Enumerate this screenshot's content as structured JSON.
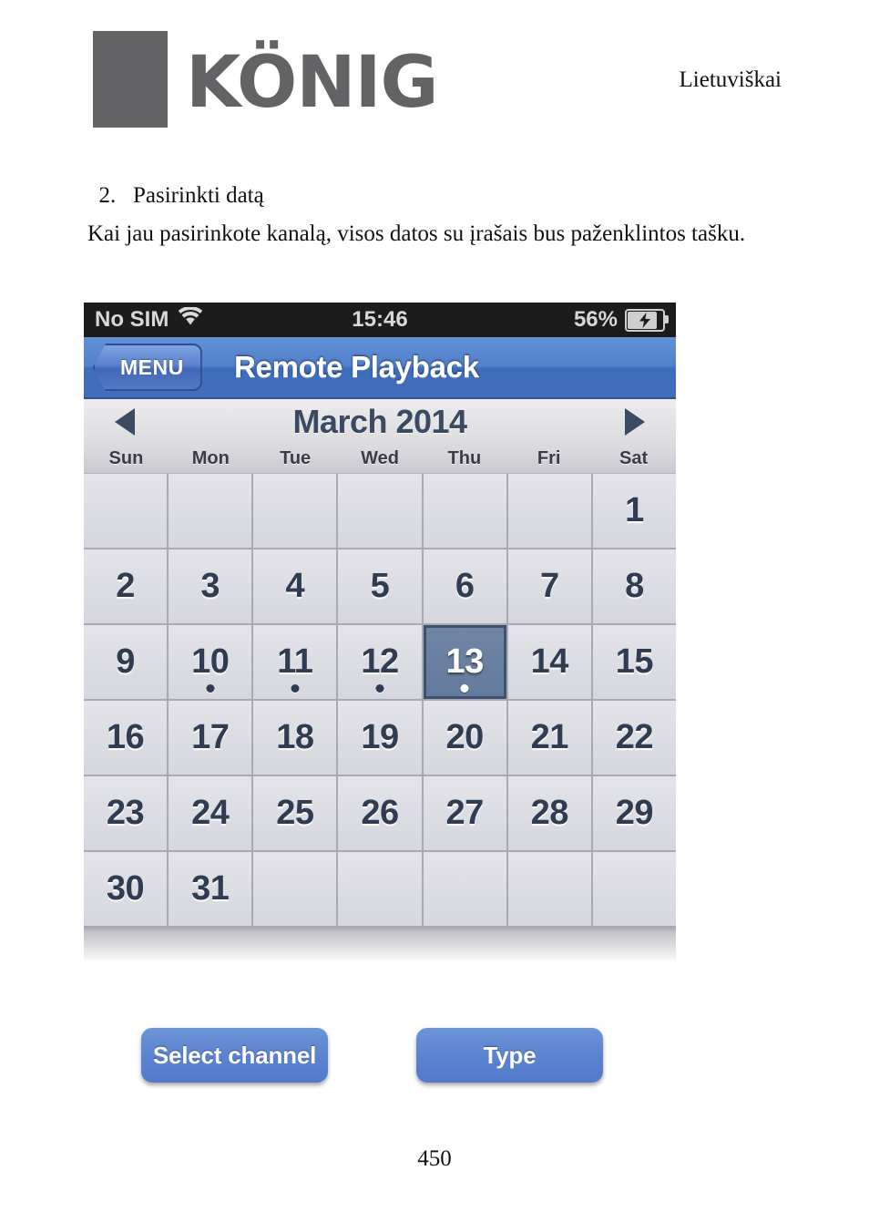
{
  "document": {
    "language_label": "Lietuviškai",
    "brand": "KÖNIG",
    "step_number": "2.",
    "step_title": "Pasirinkti datą",
    "paragraph": "Kai jau pasirinkote kanalą, visos datos su įrašais bus paženklintos tašku.",
    "page_number": "450"
  },
  "phone": {
    "statusbar": {
      "carrier": "No SIM",
      "wifi_icon": "wifi-icon",
      "time": "15:46",
      "battery_percent": "56%",
      "battery_icon": "battery-charging-icon"
    },
    "navbar": {
      "back_label": "MENU",
      "title": "Remote Playback"
    },
    "calendar": {
      "prev_icon": "triangle-left-icon",
      "next_icon": "triangle-right-icon",
      "month_title": "March 2014",
      "weekdays": [
        "Sun",
        "Mon",
        "Tue",
        "Wed",
        "Thu",
        "Fri",
        "Sat"
      ],
      "weeks": [
        [
          {
            "day": "",
            "dot": false,
            "selected": false
          },
          {
            "day": "",
            "dot": false,
            "selected": false
          },
          {
            "day": "",
            "dot": false,
            "selected": false
          },
          {
            "day": "",
            "dot": false,
            "selected": false
          },
          {
            "day": "",
            "dot": false,
            "selected": false
          },
          {
            "day": "",
            "dot": false,
            "selected": false
          },
          {
            "day": "1",
            "dot": false,
            "selected": false
          }
        ],
        [
          {
            "day": "2",
            "dot": false,
            "selected": false
          },
          {
            "day": "3",
            "dot": false,
            "selected": false
          },
          {
            "day": "4",
            "dot": false,
            "selected": false
          },
          {
            "day": "5",
            "dot": false,
            "selected": false
          },
          {
            "day": "6",
            "dot": false,
            "selected": false
          },
          {
            "day": "7",
            "dot": false,
            "selected": false
          },
          {
            "day": "8",
            "dot": false,
            "selected": false
          }
        ],
        [
          {
            "day": "9",
            "dot": false,
            "selected": false
          },
          {
            "day": "10",
            "dot": true,
            "selected": false
          },
          {
            "day": "11",
            "dot": true,
            "selected": false
          },
          {
            "day": "12",
            "dot": true,
            "selected": false
          },
          {
            "day": "13",
            "dot": true,
            "selected": true
          },
          {
            "day": "14",
            "dot": false,
            "selected": false
          },
          {
            "day": "15",
            "dot": false,
            "selected": false
          }
        ],
        [
          {
            "day": "16",
            "dot": false,
            "selected": false
          },
          {
            "day": "17",
            "dot": false,
            "selected": false
          },
          {
            "day": "18",
            "dot": false,
            "selected": false
          },
          {
            "day": "19",
            "dot": false,
            "selected": false
          },
          {
            "day": "20",
            "dot": false,
            "selected": false
          },
          {
            "day": "21",
            "dot": false,
            "selected": false
          },
          {
            "day": "22",
            "dot": false,
            "selected": false
          }
        ],
        [
          {
            "day": "23",
            "dot": false,
            "selected": false
          },
          {
            "day": "24",
            "dot": false,
            "selected": false
          },
          {
            "day": "25",
            "dot": false,
            "selected": false
          },
          {
            "day": "26",
            "dot": false,
            "selected": false
          },
          {
            "day": "27",
            "dot": false,
            "selected": false
          },
          {
            "day": "28",
            "dot": false,
            "selected": false
          },
          {
            "day": "29",
            "dot": false,
            "selected": false
          }
        ],
        [
          {
            "day": "30",
            "dot": false,
            "selected": false
          },
          {
            "day": "31",
            "dot": false,
            "selected": false
          },
          {
            "day": "",
            "dot": false,
            "selected": false
          },
          {
            "day": "",
            "dot": false,
            "selected": false
          },
          {
            "day": "",
            "dot": false,
            "selected": false
          },
          {
            "day": "",
            "dot": false,
            "selected": false
          },
          {
            "day": "",
            "dot": false,
            "selected": false
          }
        ]
      ]
    },
    "buttons": {
      "select_channel": "Select channel",
      "type": "Type"
    }
  },
  "colors": {
    "navbar_blue": "#5181c9",
    "button_blue": "#5a82cf",
    "selected_day": "#627a9c",
    "logo_gray": "#636366",
    "statusbar_black": "#1c1c1c"
  }
}
